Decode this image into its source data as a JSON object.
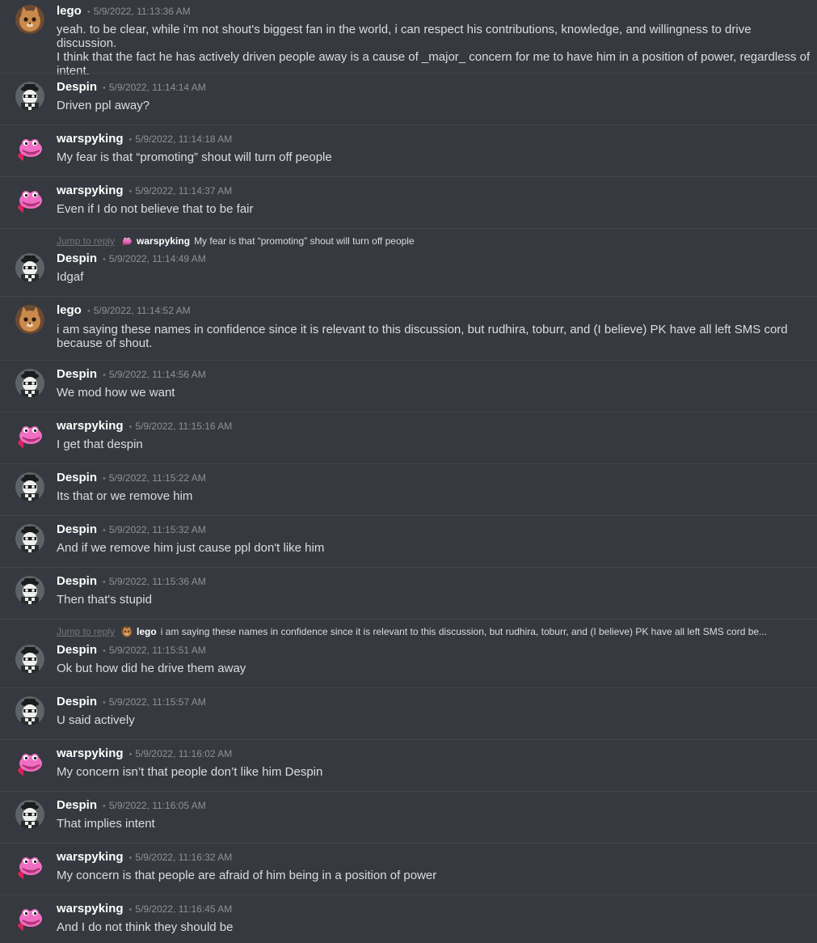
{
  "messages": [
    {
      "user": "lego",
      "avatar": "cat-avatar",
      "timestamp": "5/9/2022, 11:13:36 AM",
      "text": "yeah. to be clear, while i'm not shout's biggest fan in the world, i can respect his contributions, knowledge, and willingness to drive discussion.\nI think that the fact he has actively driven people away is a cause of _major_ concern for me to have him in a position of power, regardless of\nintent."
    },
    {
      "user": "Despin",
      "avatar": "masked-skull-avatar",
      "timestamp": "5/9/2022, 11:14:14 AM",
      "text": "Driven ppl away?"
    },
    {
      "user": "warspyking",
      "avatar": "pink-frog-avatar",
      "timestamp": "5/9/2022, 11:14:18 AM",
      "text": "My fear is that “promoting” shout will turn off people"
    },
    {
      "user": "warspyking",
      "avatar": "pink-frog-avatar",
      "timestamp": "5/9/2022, 11:14:37 AM",
      "text": "Even if I do not believe that to be fair"
    },
    {
      "reply": {
        "jump_label": "Jump to reply",
        "user": "warspyking",
        "avatar": "pink-frog-avatar",
        "text": "My fear is that “promoting” shout will turn off people"
      },
      "user": "Despin",
      "avatar": "masked-skull-avatar",
      "timestamp": "5/9/2022, 11:14:49 AM",
      "text": "Idgaf"
    },
    {
      "user": "lego",
      "avatar": "cat-avatar",
      "timestamp": "5/9/2022, 11:14:52 AM",
      "text": "i am saying these names in confidence since it is relevant to this discussion, but rudhira, toburr, and (I believe) PK have all left SMS cord\nbecause of shout."
    },
    {
      "user": "Despin",
      "avatar": "masked-skull-avatar",
      "timestamp": "5/9/2022, 11:14:56 AM",
      "text": "We mod how we want"
    },
    {
      "user": "warspyking",
      "avatar": "pink-frog-avatar",
      "timestamp": "5/9/2022, 11:15:16 AM",
      "text": "I get that despin"
    },
    {
      "user": "Despin",
      "avatar": "masked-skull-avatar",
      "timestamp": "5/9/2022, 11:15:22 AM",
      "text": "Its that or we remove him"
    },
    {
      "user": "Despin",
      "avatar": "masked-skull-avatar",
      "timestamp": "5/9/2022, 11:15:32 AM",
      "text": "And if we remove him just cause ppl don't like him"
    },
    {
      "user": "Despin",
      "avatar": "masked-skull-avatar",
      "timestamp": "5/9/2022, 11:15:36 AM",
      "text": "Then that's stupid"
    },
    {
      "reply": {
        "jump_label": "Jump to reply",
        "user": "lego",
        "avatar": "cat-avatar",
        "text": "i am saying these names in confidence since it is relevant to this discussion, but rudhira, toburr, and (I believe) PK have all left SMS cord be..."
      },
      "user": "Despin",
      "avatar": "masked-skull-avatar",
      "timestamp": "5/9/2022, 11:15:51 AM",
      "text": "Ok but how did he drive them away"
    },
    {
      "user": "Despin",
      "avatar": "masked-skull-avatar",
      "timestamp": "5/9/2022, 11:15:57 AM",
      "text": "U said actively"
    },
    {
      "user": "warspyking",
      "avatar": "pink-frog-avatar",
      "timestamp": "5/9/2022, 11:16:02 AM",
      "text": "My concern isn’t that people don’t like him Despin"
    },
    {
      "user": "Despin",
      "avatar": "masked-skull-avatar",
      "timestamp": "5/9/2022, 11:16:05 AM",
      "text": "That implies intent"
    },
    {
      "user": "warspyking",
      "avatar": "pink-frog-avatar",
      "timestamp": "5/9/2022, 11:16:32 AM",
      "text": "My concern is that people are afraid of him being in a position of power"
    },
    {
      "user": "warspyking",
      "avatar": "pink-frog-avatar",
      "timestamp": "5/9/2022, 11:16:45 AM",
      "text": "And I do not think they should be"
    }
  ],
  "separator": "•",
  "colors": {
    "background": "#36393f",
    "divider": "#42454a",
    "username": "#ffffff",
    "text": "#dcddde",
    "timestamp": "#8e9297"
  }
}
